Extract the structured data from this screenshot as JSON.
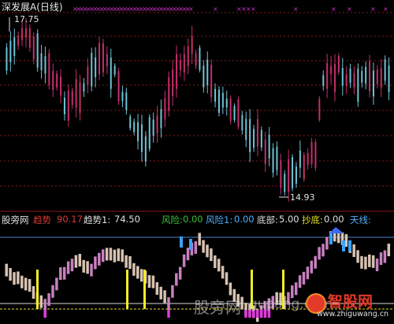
{
  "header": {
    "title": "深发展A(日线)",
    "title_color": "#e8e8e8"
  },
  "main_chart": {
    "high_label": "17.75",
    "low_label": "14.93",
    "up_color": "#c2306a",
    "down_color": "#6ec3d6",
    "grid_color": "#8a1818",
    "marker_color": "#cc33cc"
  },
  "indicator": {
    "name": "股旁网",
    "name_color": "#e0e0e0",
    "trend_label": "趋势",
    "trend_value": "90.17",
    "trend_color": "#d83a3a",
    "trend1_label": "趋势1:",
    "trend1_value": "74.50",
    "trend1_color": "#e0e0e0",
    "risk_label": "风险:",
    "risk_value": "0.00",
    "risk_color": "#37c437",
    "risk1_label": "风险1:",
    "risk1_value": "0.00",
    "risk1_color": "#4fb0ff",
    "bottom_label": "底部:",
    "bottom_value": "5.00",
    "bottom_color": "#e0e0e0",
    "buy_label": "抄底:",
    "buy_value": "0.00",
    "buy_color": "#e8e020",
    "sky_label": "天线:",
    "sky_color": "#4fb0ff"
  },
  "watermarks": {
    "site_cn": "股旁网",
    "site_en": "gupang.com",
    "brand": "智股网",
    "brand_url": "www.zhiguwang.cn"
  }
}
